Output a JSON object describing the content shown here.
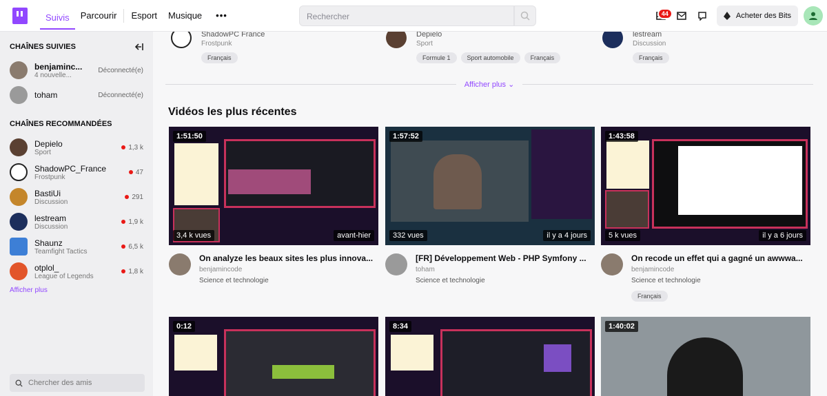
{
  "nav": {
    "links": [
      "Suivis",
      "Parcourir",
      "Esport",
      "Musique"
    ],
    "more": "•••",
    "search_placeholder": "Rechercher",
    "notif_count": "44",
    "bits_label": "Acheter des Bits"
  },
  "sidebar": {
    "followed_title": "CHAÎNES SUIVIES",
    "followed": [
      {
        "name": "benjaminc...",
        "sub": "4 nouvelle...",
        "status": "Déconnecté(e)",
        "color": "#8a7b6e"
      },
      {
        "name": "toham",
        "sub": "",
        "status": "Déconnecté(e)",
        "color": "#9a9a9a"
      }
    ],
    "recommended_title": "CHAÎNES RECOMMANDÉES",
    "recommended": [
      {
        "name": "Depielo",
        "game": "Sport",
        "viewers": "1,3 k",
        "color": "#5a4032"
      },
      {
        "name": "ShadowPC_France",
        "game": "Frostpunk",
        "viewers": "47",
        "color": "#222222"
      },
      {
        "name": "BastiUi",
        "game": "Discussion",
        "viewers": "291",
        "color": "#c4862b"
      },
      {
        "name": "lestream",
        "game": "Discussion",
        "viewers": "1,9 k",
        "color": "#1c2e5c"
      },
      {
        "name": "Shaunz",
        "game": "Teamfight Tactics",
        "viewers": "6,5 k",
        "color": "#3d7fd6"
      },
      {
        "name": "otplol_",
        "game": "League of Legends",
        "viewers": "1,8 k",
        "color": "#e2552a"
      }
    ],
    "show_more": "Afficher plus",
    "search_friends": "Chercher des amis"
  },
  "top_row": [
    {
      "name": "ShadowPC France",
      "game": "Frostpunk",
      "tags": [
        "Français"
      ],
      "color": "#222222"
    },
    {
      "name": "Depielo",
      "game": "Sport",
      "tags": [
        "Formule 1",
        "Sport automobile",
        "Français"
      ],
      "color": "#5a4032"
    },
    {
      "name": "lestream",
      "game": "Discussion",
      "tags": [
        "Français"
      ],
      "color": "#1c2e5c"
    }
  ],
  "show_more_main": "Afficher plus",
  "section_title": "Vidéos les plus récentes",
  "videos": [
    {
      "duration": "1:51:50",
      "views": "3,4 k vues",
      "ago": "avant-hier",
      "title": "On analyze les beaux sites les plus innova...",
      "channel": "benjamincode",
      "category": "Science et technologie",
      "tag": "",
      "color": "#8a7b6e"
    },
    {
      "duration": "1:57:52",
      "views": "332 vues",
      "ago": "il y a 4 jours",
      "title": "[FR] Développement Web - PHP Symfony ...",
      "channel": "toham",
      "category": "Science et technologie",
      "tag": "",
      "color": "#9a9a9a"
    },
    {
      "duration": "1:43:58",
      "views": "5 k vues",
      "ago": "il y a 6 jours",
      "title": "On recode un effet qui a gagné un awwwa...",
      "channel": "benjamincode",
      "category": "Science et technologie",
      "tag": "Français",
      "color": "#8a7b6e"
    }
  ],
  "videos_row2": [
    {
      "duration": "0:12"
    },
    {
      "duration": "8:34"
    },
    {
      "duration": "1:40:02"
    }
  ]
}
